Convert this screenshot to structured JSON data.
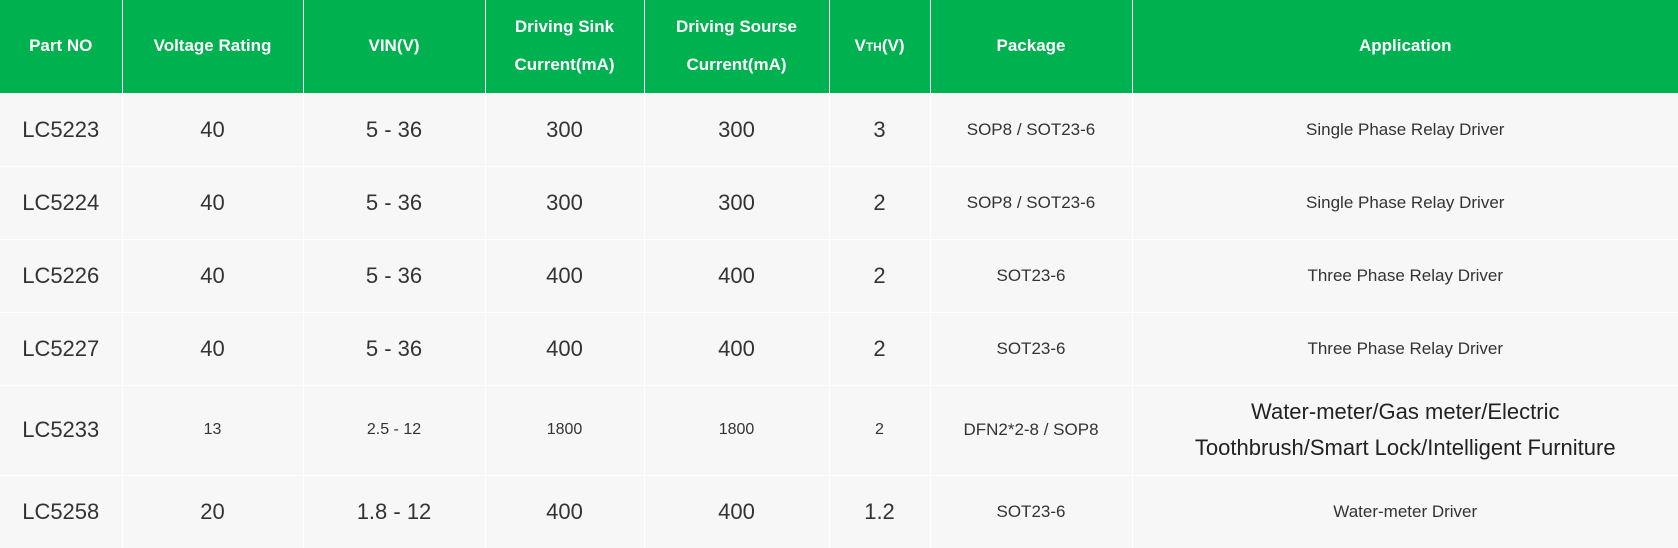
{
  "table": {
    "headers": [
      {
        "line1": "Part NO",
        "line2": ""
      },
      {
        "line1": "Voltage Rating",
        "line2": ""
      },
      {
        "line1": "VIN(V)",
        "line2": ""
      },
      {
        "line1": "Driving Sink",
        "line2": "Current(mA)"
      },
      {
        "line1": "Driving Sourse",
        "line2": "Current(mA)"
      },
      {
        "line1": "V",
        "line2": ""
      },
      {
        "line1": "Package",
        "line2": ""
      },
      {
        "line1": "Application",
        "line2": ""
      }
    ],
    "vth_header": {
      "prefix": "V",
      "sub": "TH",
      "suffix": "(V)"
    },
    "rows": [
      {
        "part": "LC5223",
        "voltage": "40",
        "vin": "5 - 36",
        "sink": "300",
        "source": "300",
        "vth": "3",
        "package": "SOP8 / SOT23-6",
        "application": "Single Phase Relay Driver"
      },
      {
        "part": "LC5224",
        "voltage": "40",
        "vin": "5 - 36",
        "sink": "300",
        "source": "300",
        "vth": "2",
        "package": "SOP8 / SOT23-6",
        "application": "Single Phase Relay Driver"
      },
      {
        "part": "LC5226",
        "voltage": "40",
        "vin": "5 - 36",
        "sink": "400",
        "source": "400",
        "vth": "2",
        "package": "SOT23-6",
        "application": "Three Phase Relay Driver"
      },
      {
        "part": "LC5227",
        "voltage": "40",
        "vin": "5 - 36",
        "sink": "400",
        "source": "400",
        "vth": "2",
        "package": "SOT23-6",
        "application": "Three Phase Relay Driver"
      },
      {
        "part": "LC5233",
        "voltage": "13",
        "vin": "2.5 - 12",
        "sink": "1800",
        "source": "1800",
        "vth": "2",
        "package": "DFN2*2-8 / SOP8",
        "application_line1": "Water-meter/Gas meter/Electric",
        "application_line2": "Toothbrush/Smart Lock/Intelligent Furniture"
      },
      {
        "part": "LC5258",
        "voltage": "20",
        "vin": "1.8 - 12",
        "sink": "400",
        "source": "400",
        "vth": "1.2",
        "package": "SOT23-6",
        "application": "Water-meter Driver"
      }
    ]
  },
  "colors": {
    "header_bg": "#00b14f",
    "header_text": "#ffffff",
    "row_bg": "#f7f7f7",
    "cell_text": "#333333"
  }
}
